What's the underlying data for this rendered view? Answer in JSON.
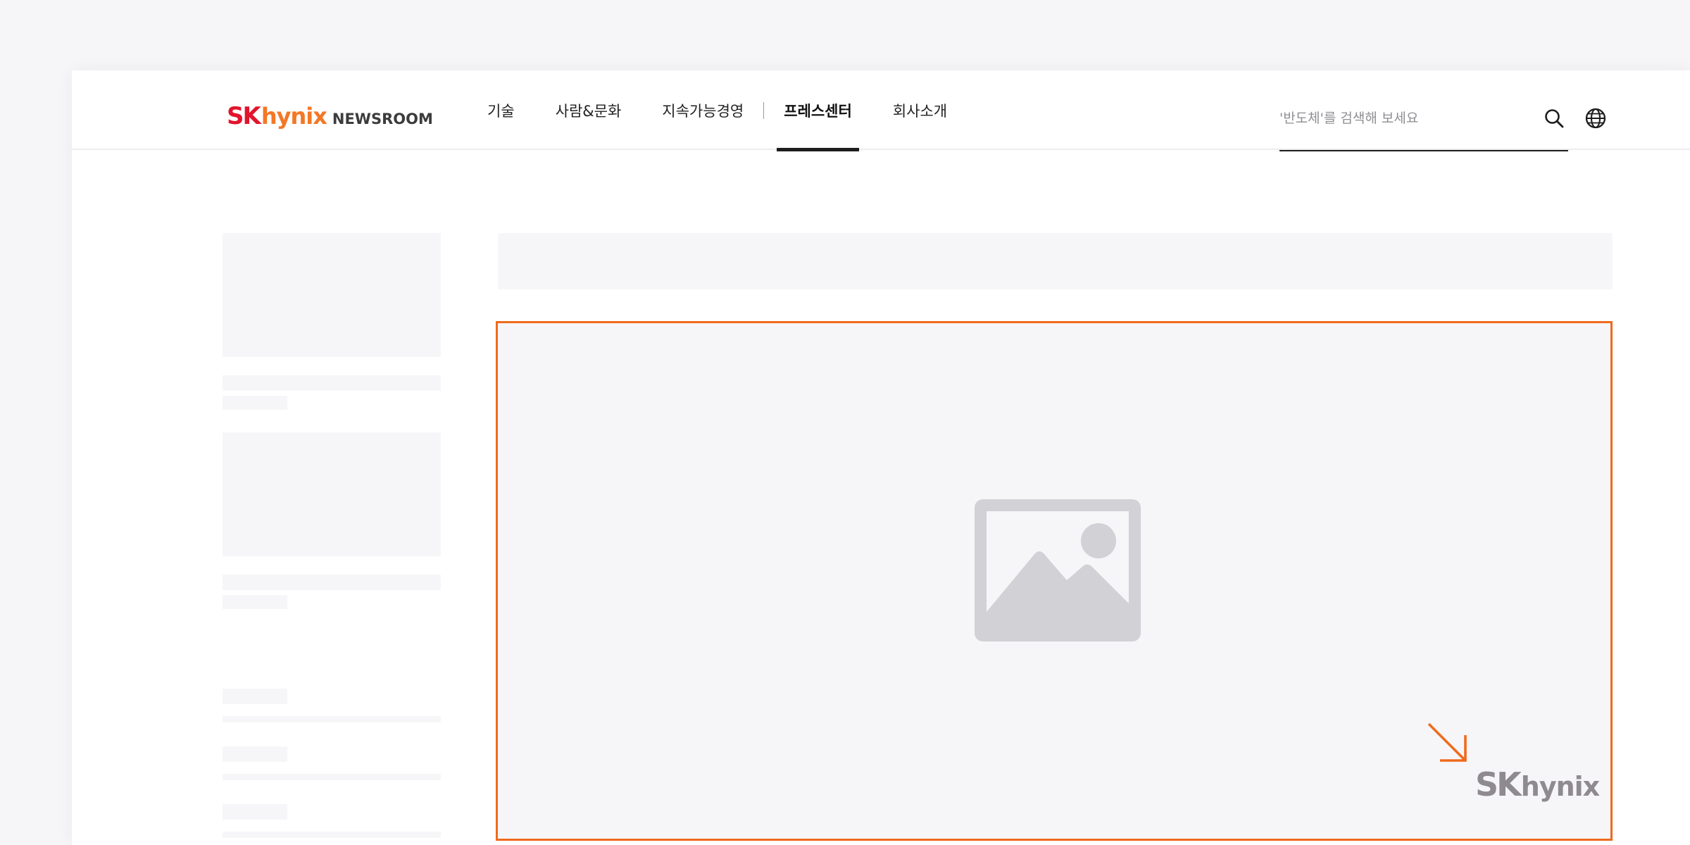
{
  "header": {
    "logo": {
      "sk": "SK",
      "hynix": "hynix",
      "newsroom": "NEWSROOM"
    },
    "nav": [
      {
        "label": "기술"
      },
      {
        "label": "사람&문화"
      },
      {
        "label": "지속가능경영"
      },
      {
        "label": "프레스센터",
        "active": true
      },
      {
        "label": "회사소개"
      }
    ],
    "search": {
      "placeholder": "'반도체'를 검색해 보세요",
      "value": ""
    }
  },
  "main": {
    "image": {
      "type": "image-placeholder",
      "watermark": {
        "sk": "SK",
        "hynix": "hynix"
      }
    }
  },
  "colors": {
    "brand_red": "#e2142d",
    "brand_orange": "#f47725",
    "accent_border": "#ef6a1c",
    "skeleton": "#f6f6f8"
  },
  "icons": [
    "search-icon",
    "globe-icon",
    "image-placeholder-icon",
    "arrow-down-right-icon"
  ]
}
